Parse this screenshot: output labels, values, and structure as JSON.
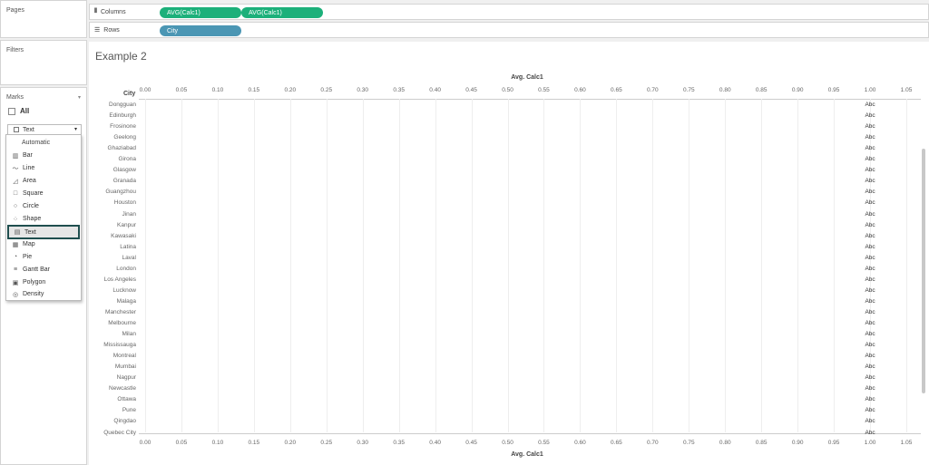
{
  "pages": {
    "title": "Pages"
  },
  "filters": {
    "title": "Filters"
  },
  "marks": {
    "title": "Marks",
    "all_label": "All",
    "selected_type": "Text",
    "options": [
      {
        "label": "Automatic",
        "icon": "none"
      },
      {
        "label": "Bar",
        "icon": "bar-chart-icon"
      },
      {
        "label": "Line",
        "icon": "line-chart-icon"
      },
      {
        "label": "Area",
        "icon": "area-chart-icon"
      },
      {
        "label": "Square",
        "icon": "square-icon"
      },
      {
        "label": "Circle",
        "icon": "circle-icon"
      },
      {
        "label": "Shape",
        "icon": "shape-icon"
      },
      {
        "label": "Text",
        "icon": "text-icon"
      },
      {
        "label": "Map",
        "icon": "map-icon"
      },
      {
        "label": "Pie",
        "icon": "pie-icon"
      },
      {
        "label": "Gantt Bar",
        "icon": "gantt-icon"
      },
      {
        "label": "Polygon",
        "icon": "polygon-icon"
      },
      {
        "label": "Density",
        "icon": "density-icon"
      }
    ]
  },
  "shelves": {
    "columns_label": "Columns",
    "rows_label": "Rows",
    "column_pills": [
      "AVG(Calc1)",
      "AVG(Calc1)"
    ],
    "row_pills": [
      "City"
    ],
    "green": "#1cb07a",
    "blue": "#4b96b4"
  },
  "view": {
    "title": "Example 2"
  },
  "chart_data": {
    "type": "table",
    "title": "Example 2",
    "xlabel": "Avg. Calc1",
    "ylabel": "City",
    "xlim": [
      0,
      1.05
    ],
    "ticks": [
      "0.00",
      "0.05",
      "0.10",
      "0.15",
      "0.20",
      "0.25",
      "0.30",
      "0.35",
      "0.40",
      "0.45",
      "0.50",
      "0.55",
      "0.60",
      "0.65",
      "0.70",
      "0.75",
      "0.80",
      "0.85",
      "0.90",
      "0.95",
      "1.00",
      "1.05"
    ],
    "categories": [
      "Dongguan",
      "Edinburgh",
      "Frosinone",
      "Geelong",
      "Ghaziabad",
      "Girona",
      "Glasgow",
      "Granada",
      "Guangzhou",
      "Houston",
      "Jinan",
      "Kanpur",
      "Kawasaki",
      "Latina",
      "Laval",
      "London",
      "Los Angeles",
      "Lucknow",
      "Malaga",
      "Manchester",
      "Melbourne",
      "Milan",
      "Mississauga",
      "Montreal",
      "Mumbai",
      "Nagpur",
      "Newcastle",
      "Ottawa",
      "Pune",
      "Qingdao",
      "Quebec City"
    ],
    "values": [
      1,
      1,
      1,
      1,
      1,
      1,
      1,
      1,
      1,
      1,
      1,
      1,
      1,
      1,
      1,
      1,
      1,
      1,
      1,
      1,
      1,
      1,
      1,
      1,
      1,
      1,
      1,
      1,
      1,
      1,
      1
    ],
    "mark_text": "Abc",
    "grid": true
  }
}
